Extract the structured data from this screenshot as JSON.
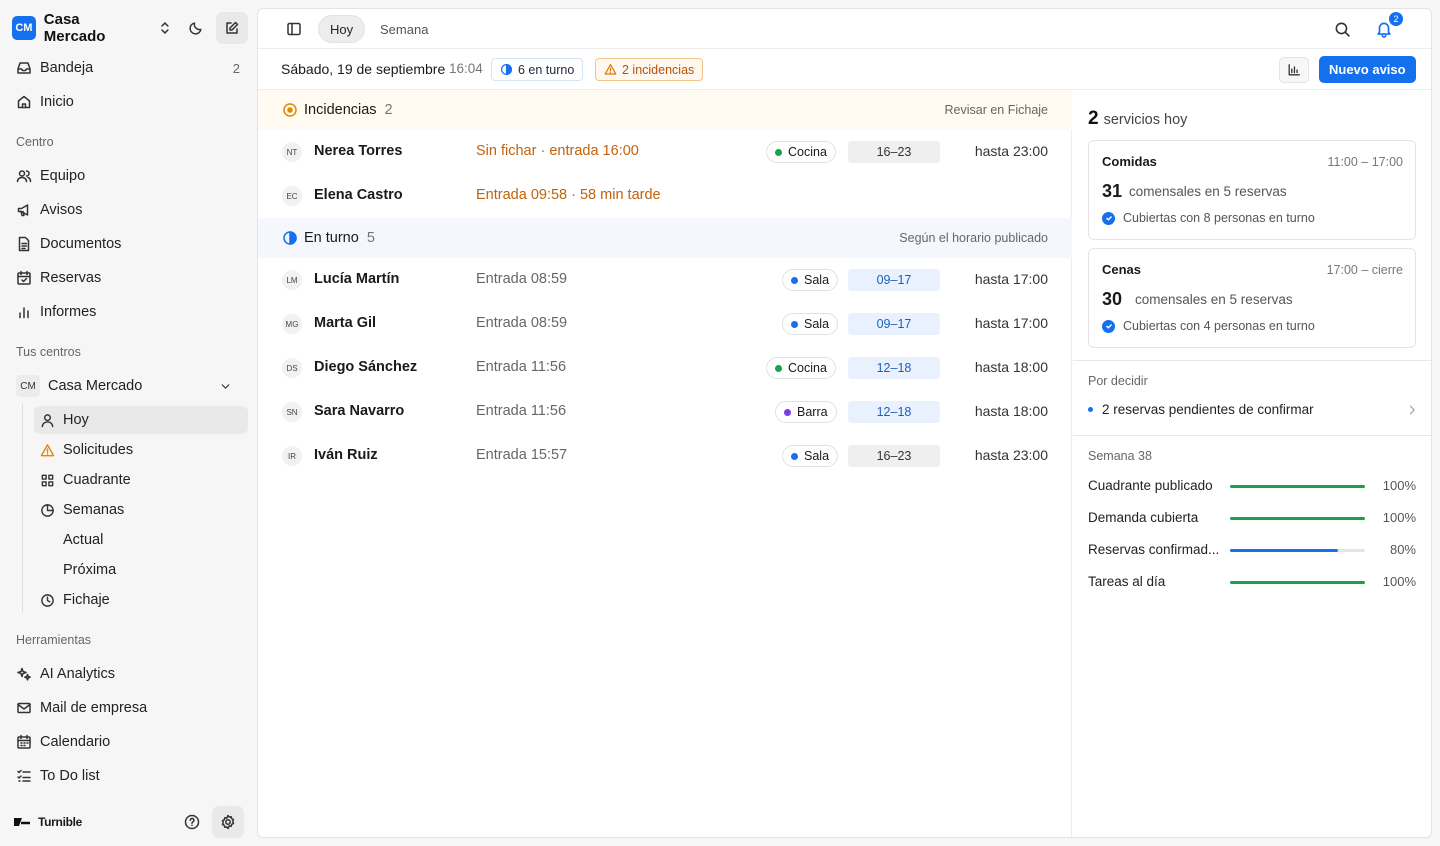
{
  "sidebar": {
    "logo_initials": "CM",
    "brand": "Casa Mercado",
    "nav": [
      {
        "label": "Bandeja",
        "count": "2",
        "icon": "inbox-icon"
      },
      {
        "label": "Inicio",
        "icon": "home-icon"
      }
    ],
    "section_centro": "Centro",
    "centro_items": [
      {
        "label": "Equipo",
        "icon": "users-icon"
      },
      {
        "label": "Avisos",
        "icon": "megaphone-icon"
      },
      {
        "label": "Documentos",
        "icon": "document-icon"
      },
      {
        "label": "Reservas",
        "icon": "calendar-check-icon"
      },
      {
        "label": "Informes",
        "icon": "bar-chart-icon"
      }
    ],
    "section_centros": "Tus centros",
    "center": {
      "initials": "CM",
      "name": "Casa Mercado"
    },
    "center_items": [
      {
        "label": "Hoy",
        "icon": "user-icon",
        "active": true
      },
      {
        "label": "Solicitudes",
        "icon": "warning-icon"
      },
      {
        "label": "Cuadrante",
        "icon": "grid-icon"
      },
      {
        "label": "Semanas",
        "icon": "pie-icon"
      },
      {
        "label": "Actual"
      },
      {
        "label": "Próxima"
      },
      {
        "label": "Fichaje",
        "icon": "clock-icon"
      }
    ],
    "section_tools": "Herramientas",
    "tools": [
      {
        "label": "AI Analytics",
        "icon": "sparkles-icon"
      },
      {
        "label": "Mail de empresa",
        "icon": "mail-icon"
      },
      {
        "label": "Calendario",
        "icon": "calendar-icon"
      },
      {
        "label": "To Do list",
        "icon": "checklist-icon"
      }
    ],
    "footer_brand": "Turnible"
  },
  "topbar": {
    "tabs": [
      "Hoy",
      "Semana"
    ],
    "active_tab": "Hoy",
    "notif_count": "2"
  },
  "datebar": {
    "date": "Sábado, 19 de septiembre",
    "time": "16:04",
    "on_shift_chip": "6 en turno",
    "incidents_chip": "2 incidencias",
    "new_button": "Nuevo aviso"
  },
  "incidencias": {
    "title": "Incidencias",
    "count": "2",
    "link": "Revisar en Fichaje",
    "rows": [
      {
        "initials": "NT",
        "name": "Nerea Torres",
        "status": "Sin fichar · entrada 16:00",
        "role": "Cocina",
        "role_color": "#16a34a",
        "shift": "16–23",
        "until": "hasta 23:00"
      },
      {
        "initials": "EC",
        "name": "Elena Castro",
        "status": "Entrada 09:58 · 58 min tarde"
      }
    ]
  },
  "en_turno": {
    "title": "En turno",
    "count": "5",
    "note": "Según el horario publicado",
    "rows": [
      {
        "initials": "LM",
        "name": "Lucía Martín",
        "status": "Entrada 08:59",
        "role": "Sala",
        "role_color": "#1570ef",
        "shift": "09–17",
        "until": "hasta 17:00"
      },
      {
        "initials": "MG",
        "name": "Marta Gil",
        "status": "Entrada 08:59",
        "role": "Sala",
        "role_color": "#1570ef",
        "shift": "09–17",
        "until": "hasta 17:00"
      },
      {
        "initials": "DS",
        "name": "Diego Sánchez",
        "status": "Entrada 11:56",
        "role": "Cocina",
        "role_color": "#16a34a",
        "shift": "12–18",
        "until": "hasta 18:00"
      },
      {
        "initials": "SN",
        "name": "Sara Navarro",
        "status": "Entrada 11:56",
        "role": "Barra",
        "role_color": "#7c3aed",
        "shift": "12–18",
        "until": "hasta 18:00"
      },
      {
        "initials": "IR",
        "name": "Iván Ruiz",
        "status": "Entrada 15:57",
        "role": "Sala",
        "role_color": "#1570ef",
        "shift": "16–23",
        "until": "hasta 23:00"
      }
    ]
  },
  "right": {
    "services_count": "2",
    "services_label": "servicios hoy",
    "services": [
      {
        "name": "Comidas",
        "range": "11:00 – 17:00",
        "covers": "31",
        "covers_label": "comensales en 5 reservas",
        "ok": "Cubiertas con 8 personas en turno"
      },
      {
        "name": "Cenas",
        "range": "17:00 – cierre",
        "covers": "30",
        "covers_label": "comensales en 5 reservas",
        "ok": "Cubiertas con 4 personas en turno"
      }
    ],
    "pending_label": "Por decidir",
    "pending_item": "2 reservas pendientes de confirmar",
    "week_label": "Semana 38",
    "metrics": [
      {
        "label": "Cuadrante publicado",
        "value": 100,
        "display": "100%",
        "color": "#16a34a"
      },
      {
        "label": "Demanda cubierta",
        "value": 100,
        "display": "100%",
        "color": "#16a34a"
      },
      {
        "label": "Reservas confirmad...",
        "value": 80,
        "display": "80%",
        "color": "#1570ef"
      },
      {
        "label": "Tareas al día",
        "value": 100,
        "display": "100%",
        "color": "#16a34a"
      }
    ]
  }
}
